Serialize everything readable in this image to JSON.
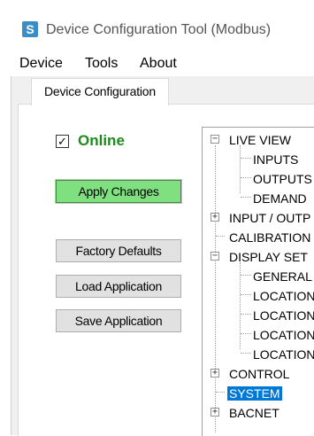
{
  "window": {
    "title": "Device Configuration Tool (Modbus)",
    "icon_letter": "S"
  },
  "menu": [
    {
      "label": "Device"
    },
    {
      "label": "Tools"
    },
    {
      "label": "About"
    }
  ],
  "tabs": [
    {
      "label": "Device Configuration"
    }
  ],
  "status": {
    "online_label": "Online",
    "online_checked": true,
    "check_glyph": "✓"
  },
  "buttons": {
    "apply": "Apply Changes",
    "factory_defaults": "Factory Defaults",
    "load_application": "Load Application",
    "save_application": "Save Application"
  },
  "tree": {
    "expand_glyph": "+",
    "collapse_glyph": "−",
    "nodes": [
      {
        "label": "LIVE VIEW",
        "state": "expanded"
      },
      {
        "label": "INPUTS"
      },
      {
        "label": "OUTPUTS"
      },
      {
        "label": "DEMAND"
      },
      {
        "label": "INPUT / OUTP",
        "state": "collapsed"
      },
      {
        "label": "CALIBRATION"
      },
      {
        "label": "DISPLAY SET",
        "state": "expanded"
      },
      {
        "label": "GENERAL"
      },
      {
        "label": "LOCATION"
      },
      {
        "label": "LOCATION"
      },
      {
        "label": "LOCATION"
      },
      {
        "label": "LOCATION"
      },
      {
        "label": "CONTROL",
        "state": "collapsed"
      },
      {
        "label": "SYSTEM",
        "selected": true
      },
      {
        "label": "BACNET",
        "state": "collapsed"
      }
    ]
  }
}
